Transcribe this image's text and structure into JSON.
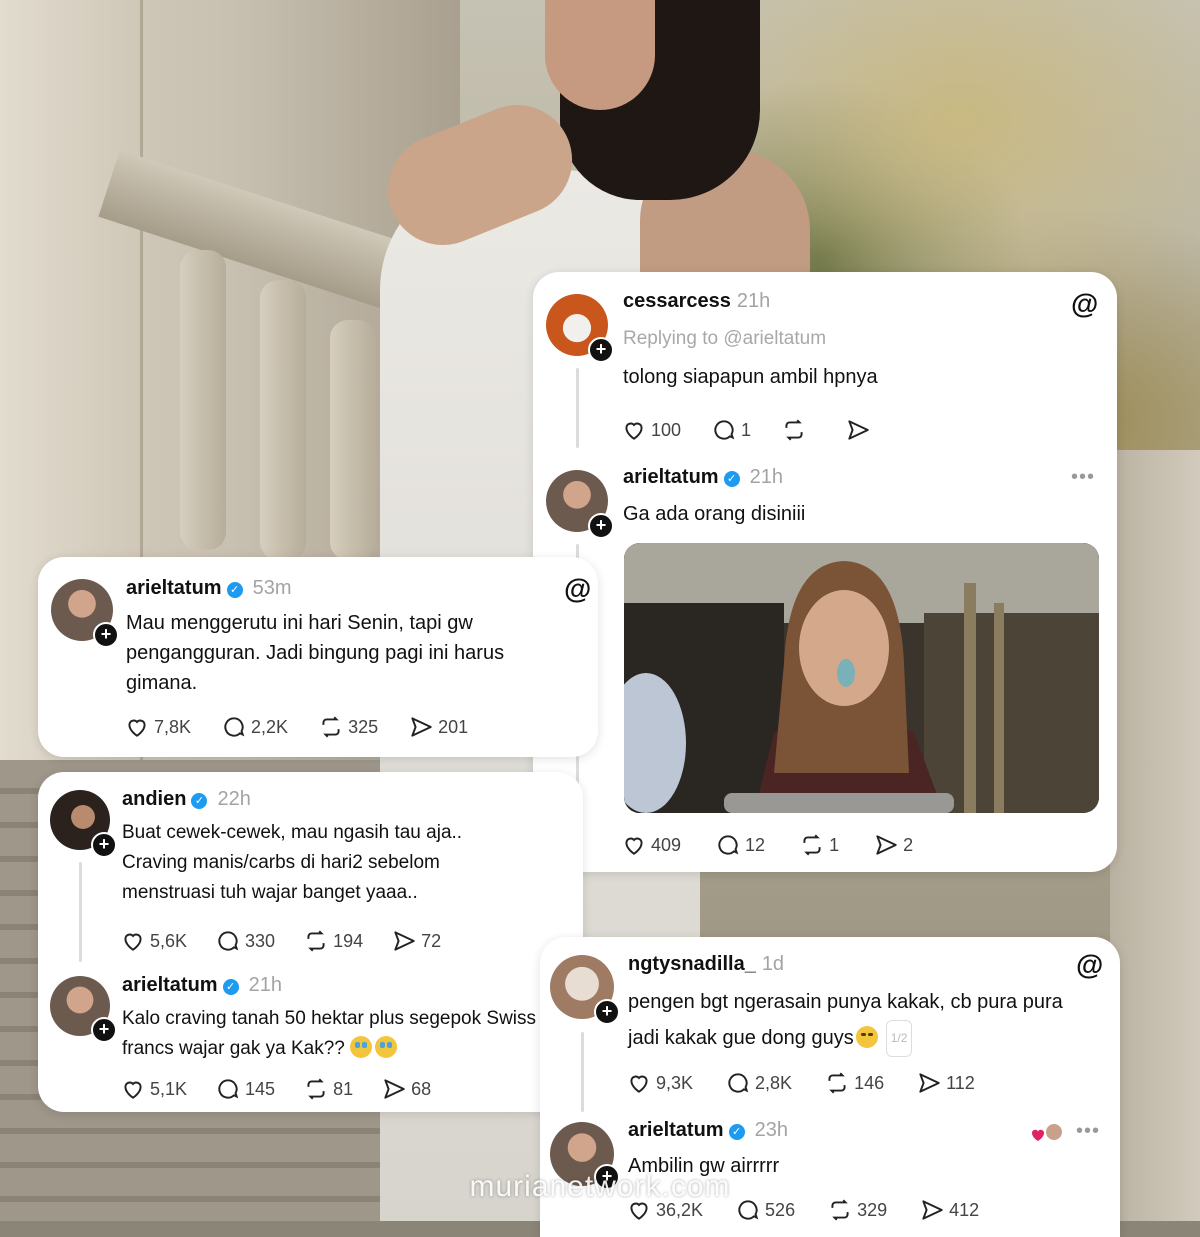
{
  "card1": {
    "post1": {
      "username": "cessarcess",
      "time": "21h",
      "replying": "Replying to @arieltatum",
      "text": "tolong siapapun ambil hpnya",
      "likes": "100",
      "replies": "1",
      "reposts": "",
      "shares": ""
    },
    "post2": {
      "username": "arieltatum",
      "time": "21h",
      "text": "Ga ada orang disiniii",
      "likes": "409",
      "replies": "12",
      "reposts": "1",
      "shares": "2"
    }
  },
  "card2": {
    "post1": {
      "username": "arieltatum",
      "time": "53m",
      "text": "Mau menggerutu ini hari Senin, tapi gw pengangguran. Jadi bingung pagi ini harus gimana.",
      "likes": "7,8K",
      "replies": "2,2K",
      "reposts": "325",
      "shares": "201"
    }
  },
  "card3": {
    "post1": {
      "username": "andien",
      "time": "22h",
      "text": "Buat cewek-cewek, mau ngasih tau aja.. Craving manis/carbs di hari2 sebelom menstruasi tuh wajar banget yaaa..",
      "likes": "5,6K",
      "replies": "330",
      "reposts": "194",
      "shares": "72"
    },
    "post2": {
      "username": "arieltatum",
      "time": "21h",
      "text": "Kalo craving tanah 50 hektar plus segepok Swiss francs wajar gak ya Kak??",
      "likes": "5,1K",
      "replies": "145",
      "reposts": "81",
      "shares": "68"
    }
  },
  "card4": {
    "post1": {
      "username": "ngtysnadilla_",
      "time": "1d",
      "text": "pengen bgt ngerasain punya kakak, cb pura pura jadi kakak gue dong guys",
      "page": "1/2",
      "likes": "9,3K",
      "replies": "2,8K",
      "reposts": "146",
      "shares": "112"
    },
    "post2": {
      "username": "arieltatum",
      "time": "23h",
      "text": "Ambilin gw airrrrr",
      "likes": "36,2K",
      "replies": "526",
      "reposts": "329",
      "shares": "412"
    }
  },
  "watermark": "murianetwork.com",
  "colors": {
    "verified": "#1d9bf0",
    "card": "#ffffff",
    "muted": "#a3a3a3"
  },
  "icons": [
    "threads-logo-icon",
    "heart-icon",
    "comment-icon",
    "repost-icon",
    "share-icon",
    "verified-icon",
    "more-icon",
    "plus-icon"
  ]
}
